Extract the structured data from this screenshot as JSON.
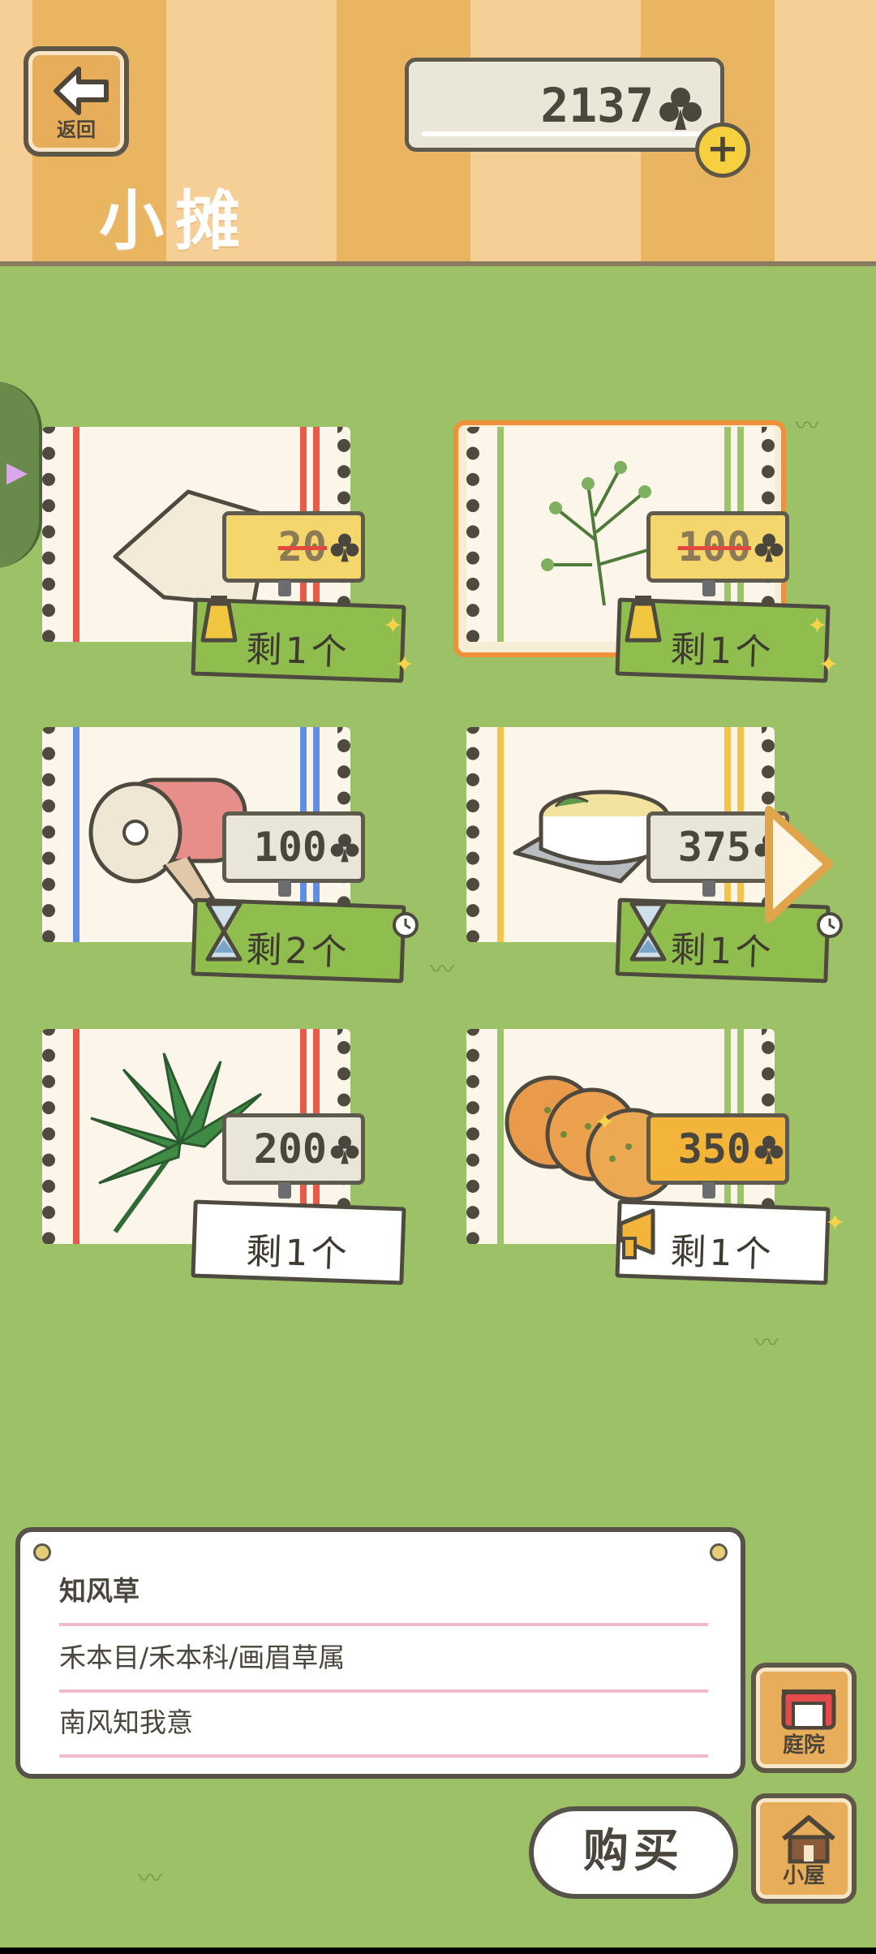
{
  "header": {
    "back_label": "返回",
    "title": "小摊",
    "currency": "2137",
    "add_label": "+"
  },
  "items": [
    {
      "price": "20",
      "stock": "剩1个",
      "status": "sale",
      "badge": "bell-icon"
    },
    {
      "price": "100",
      "stock": "剩1个",
      "status": "sale",
      "badge": "bell-icon",
      "selected": true
    },
    {
      "price": "100",
      "stock": "剩2个",
      "status": "timed",
      "badge": "hourglass-icon"
    },
    {
      "price": "375",
      "stock": "剩1个",
      "status": "timed",
      "badge": "hourglass-icon"
    },
    {
      "price": "200",
      "stock": "剩1个",
      "status": "normal"
    },
    {
      "price": "350",
      "stock": "剩1个",
      "status": "hot",
      "badge": "horn-icon"
    }
  ],
  "detail": {
    "name": "知风草",
    "taxonomy": "禾本目/禾本科/画眉草属",
    "description": "南风知我意"
  },
  "nav": {
    "yard_label": "庭院",
    "house_label": "小屋",
    "buy_label": "购买"
  },
  "colors": {
    "grass": "#9dc166",
    "header_stripe_dark": "#eab561",
    "header_stripe_light": "#f5cf96",
    "selection": "#f0913a",
    "stock_green": "#8fbd4e",
    "hot_price": "#f3b43a"
  }
}
